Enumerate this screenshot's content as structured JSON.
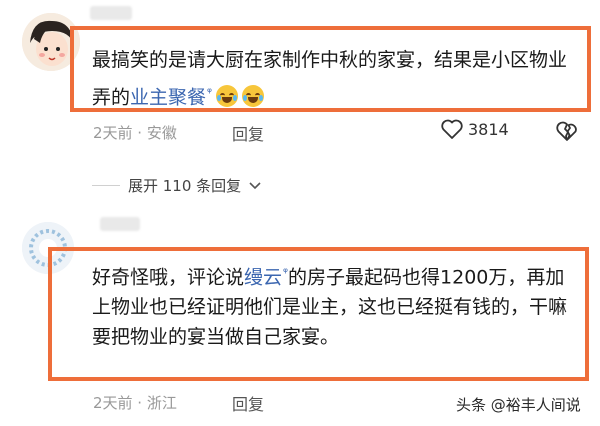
{
  "comments": [
    {
      "text_before": "最搞笑的是请大厨在家制作中秋的家宴，结果是小区物业弄的",
      "link_text": "业主聚餐",
      "meta": "2天前 · 安徽",
      "reply_label": "回复",
      "like_count": "3814"
    },
    {
      "text_before": "好奇怪哦，评论说",
      "link_text": "缦云",
      "text_after": "的房子最起码也得1200万，再加上物业也已经证明他们是业主，这也已经挺有钱的，干嘛要把物业的宴当做自己家宴。",
      "meta": "2天前 · 浙江",
      "reply_label": "回复"
    }
  ],
  "expand_replies_label": "展开 110 条回复",
  "watermark": "头条 @裕丰人间说",
  "colors": {
    "highlight_border": "#ee6e3a",
    "link": "#3b66b0",
    "meta": "#999999"
  },
  "icons": {
    "like": "heart-outline-icon",
    "dislike": "broken-heart-icon",
    "link_search": "search-superscript-icon",
    "emoji": "laugh-cry-emoji-icon",
    "expand": "chevron-down-icon"
  }
}
